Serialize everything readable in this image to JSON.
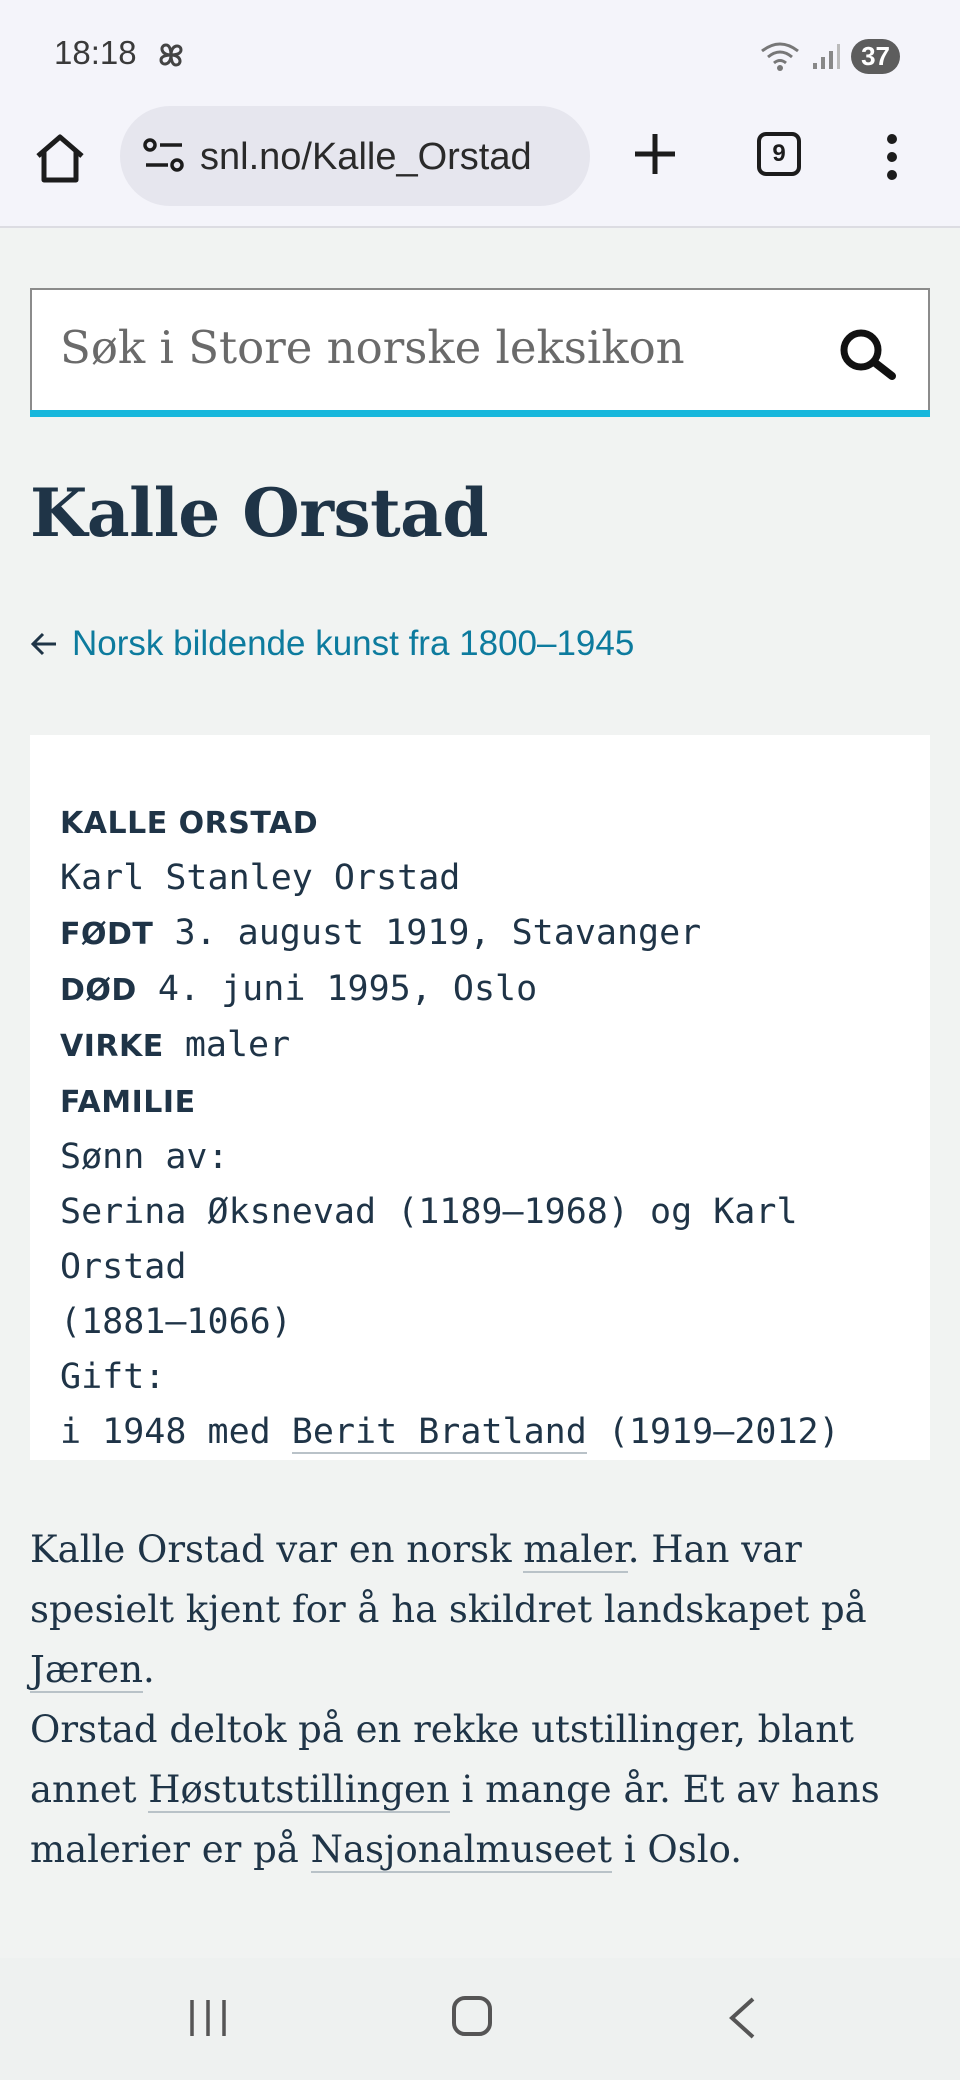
{
  "status_bar": {
    "time": "18:18",
    "battery": "37"
  },
  "browser": {
    "url": "snl.no/Kalle_Orstad",
    "tab_count": "9"
  },
  "search": {
    "placeholder": "Søk i Store norske leksikon"
  },
  "article": {
    "title": "Kalle Orstad",
    "breadcrumb": "Norsk bildende kunst fra 1800–1945",
    "facts": {
      "name_label": "KALLE ORSTAD",
      "full_name": "Karl Stanley Orstad",
      "born_label": "FØDT",
      "born_value": "3. august 1919, Stavanger",
      "died_label": "DØD",
      "died_value": "4. juni 1995, Oslo",
      "occupation_label": "VIRKE",
      "occupation_value": "maler",
      "family_label": "FAMILIE",
      "son_of_label": "Sønn av:",
      "parents_line1": "Serina Øksnevad (1189–1968) og Karl Orstad",
      "parents_line2": "(1881–1066)",
      "married_label": "Gift:",
      "married_prefix": "i 1948 med",
      "spouse_link": "Berit Bratland",
      "spouse_years": "(1919–2012)"
    },
    "paragraph1": {
      "t1": "Kalle Orstad var en norsk",
      "link1": "maler",
      "t2": ". Han var spesielt kjent for å ha skildret landskapet på",
      "link2": "Jæren",
      "t3": "."
    },
    "paragraph2": {
      "t1": "Orstad deltok på en rekke utstillinger, blant annet",
      "link1": "Høstutstillingen",
      "t2": "i mange år. Et av hans malerier er på",
      "link2": "Nasjonalmuseet",
      "t3": "i Oslo."
    }
  }
}
